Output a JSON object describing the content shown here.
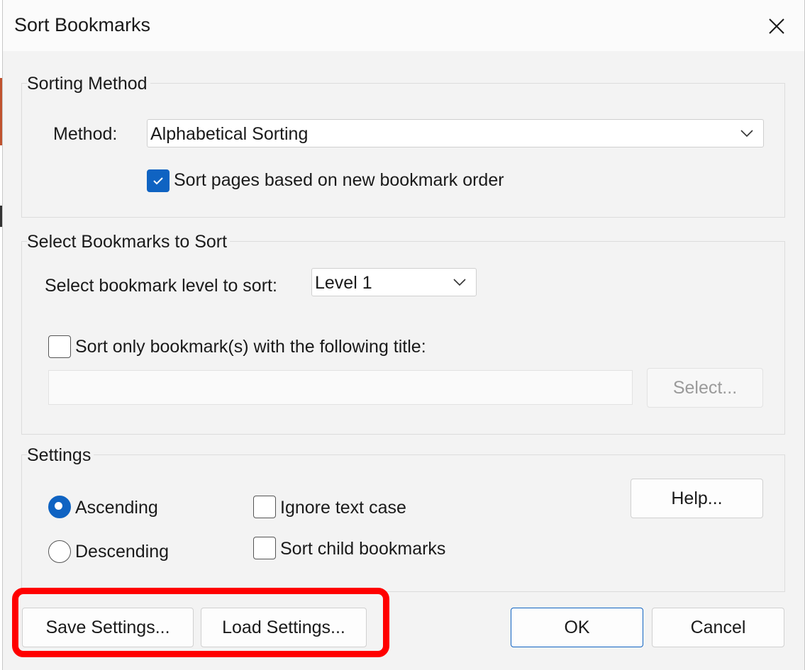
{
  "window": {
    "title": "Sort Bookmarks",
    "close_icon": "close-icon"
  },
  "sorting_method": {
    "group_label": "Sorting Method",
    "method_label": "Method:",
    "method_value": "Alphabetical Sorting",
    "sort_pages_label": "Sort pages based on new bookmark order",
    "sort_pages_checked": true
  },
  "select_bookmarks": {
    "group_label": "Select Bookmarks to Sort",
    "level_label": "Select bookmark level to sort:",
    "level_value": "Level 1",
    "title_only_label": "Sort only bookmark(s) with the following title:",
    "title_only_checked": false,
    "title_value": "",
    "select_button": "Select..."
  },
  "settings": {
    "group_label": "Settings",
    "ascending_label": "Ascending",
    "descending_label": "Descending",
    "order_selected": "Ascending",
    "ignore_case_label": "Ignore text case",
    "ignore_case_checked": false,
    "sort_child_label": "Sort child bookmarks",
    "sort_child_checked": false,
    "help_button": "Help..."
  },
  "footer": {
    "save_settings": "Save Settings...",
    "load_settings": "Load Settings...",
    "ok": "OK",
    "cancel": "Cancel"
  },
  "colors": {
    "accent": "#0f63c2",
    "highlight": "#ff0000"
  }
}
